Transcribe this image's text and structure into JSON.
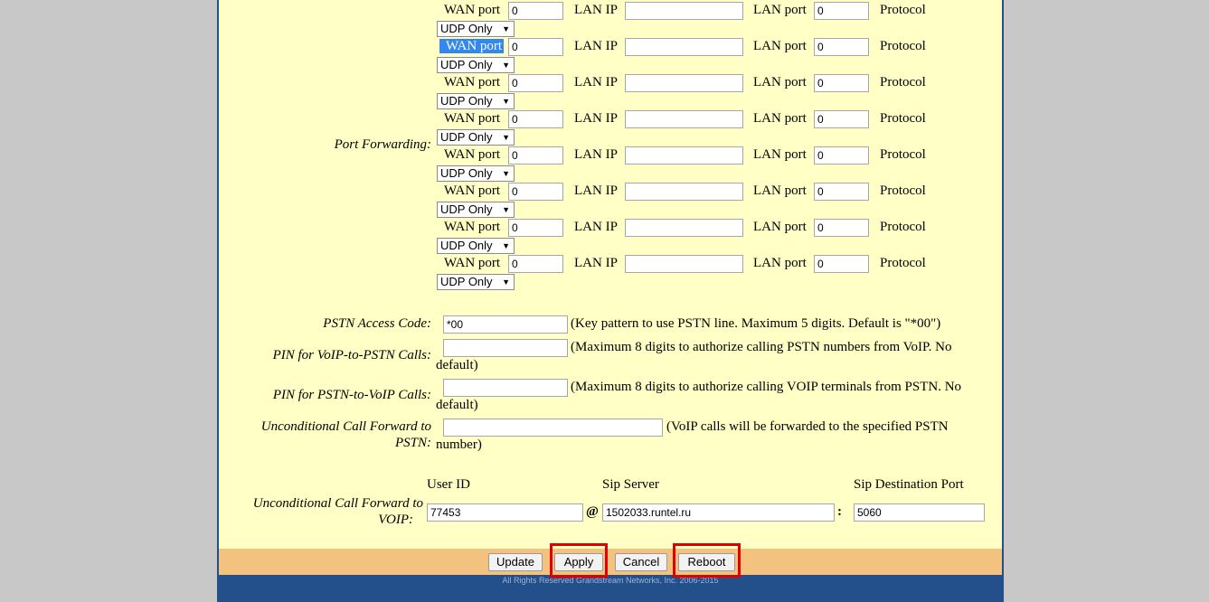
{
  "port_forwarding": {
    "label": "Port Forwarding:",
    "wan_label": "WAN port",
    "lan_ip_label": "LAN IP",
    "lan_port_label": "LAN port",
    "protocol_label": "Protocol",
    "rows": [
      {
        "wan_port": "0",
        "lan_ip": "",
        "lan_port": "0",
        "protocol": "UDP Only"
      },
      {
        "wan_port": "0",
        "lan_ip": "",
        "lan_port": "0",
        "protocol": "UDP Only"
      },
      {
        "wan_port": "0",
        "lan_ip": "",
        "lan_port": "0",
        "protocol": "UDP Only"
      },
      {
        "wan_port": "0",
        "lan_ip": "",
        "lan_port": "0",
        "protocol": "UDP Only"
      },
      {
        "wan_port": "0",
        "lan_ip": "",
        "lan_port": "0",
        "protocol": "UDP Only"
      },
      {
        "wan_port": "0",
        "lan_ip": "",
        "lan_port": "0",
        "protocol": "UDP Only"
      },
      {
        "wan_port": "0",
        "lan_ip": "",
        "lan_port": "0",
        "protocol": "UDP Only"
      },
      {
        "wan_port": "0",
        "lan_ip": "",
        "lan_port": "0",
        "protocol": "UDP Only"
      }
    ]
  },
  "pstn_access_code": {
    "label": "PSTN Access Code:",
    "value": "*00",
    "hint": "(Key pattern to use PSTN line. Maximum 5 digits. Default is \"*00\")"
  },
  "pin_voip_to_pstn": {
    "label": "PIN for VoIP-to-PSTN Calls:",
    "value": "",
    "hint1": "(Maximum 8 digits to authorize calling PSTN numbers from VoIP.  No",
    "hint2": "default)"
  },
  "pin_pstn_to_voip": {
    "label": "PIN for PSTN-to-VoIP Calls:",
    "value": "",
    "hint1": "(Maximum 8 digits to authorize calling VOIP terminals from PSTN.  No",
    "hint2": "default)"
  },
  "forward_to_pstn": {
    "label1": "Unconditional Call Forward to",
    "label2": "PSTN:",
    "value": "",
    "hint1": "(VoIP calls will be forwarded to the specified PSTN",
    "hint2": "number)"
  },
  "forward_to_voip": {
    "label1": "Unconditional Call Forward to",
    "label2": "VOIP:",
    "user_id_header": "User ID",
    "sip_server_header": "Sip Server",
    "sip_port_header": "Sip Destination Port",
    "user_id": "77453",
    "at_sign": "@",
    "sip_server": "1502033.runtel.ru",
    "colon": ":",
    "sip_port": "5060"
  },
  "buttons": {
    "update": "Update",
    "apply": "Apply",
    "cancel": "Cancel",
    "reboot": "Reboot"
  },
  "footer": {
    "copyright": "All Rights Reserved Grandstream Networks, Inc. 2006-2015"
  },
  "colors": {
    "panel_bg": "#ffffc6",
    "footer_bar": "#f3c27e",
    "copyright_bar": "#234f8a",
    "highlight": "#e00000",
    "selection": "#3388ee"
  }
}
